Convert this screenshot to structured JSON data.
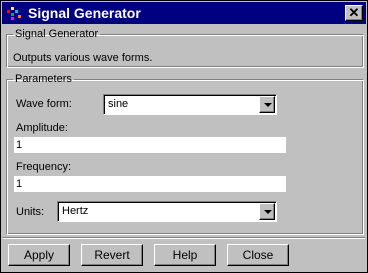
{
  "window": {
    "title": "Signal Generator",
    "close_glyph": "✕",
    "icon": "signal-generator-app-icon"
  },
  "info_group": {
    "legend": "Signal Generator",
    "description": "Outputs various wave forms."
  },
  "params_group": {
    "legend": "Parameters",
    "wave_form": {
      "label": "Wave form:",
      "value": "sine"
    },
    "amplitude": {
      "label": "Amplitude:",
      "value": "1"
    },
    "frequency": {
      "label": "Frequency:",
      "value": "1"
    },
    "units": {
      "label": "Units:",
      "value": "Hertz"
    }
  },
  "buttons": {
    "apply": "Apply",
    "revert": "Revert",
    "help": "Help",
    "close": "Close"
  }
}
